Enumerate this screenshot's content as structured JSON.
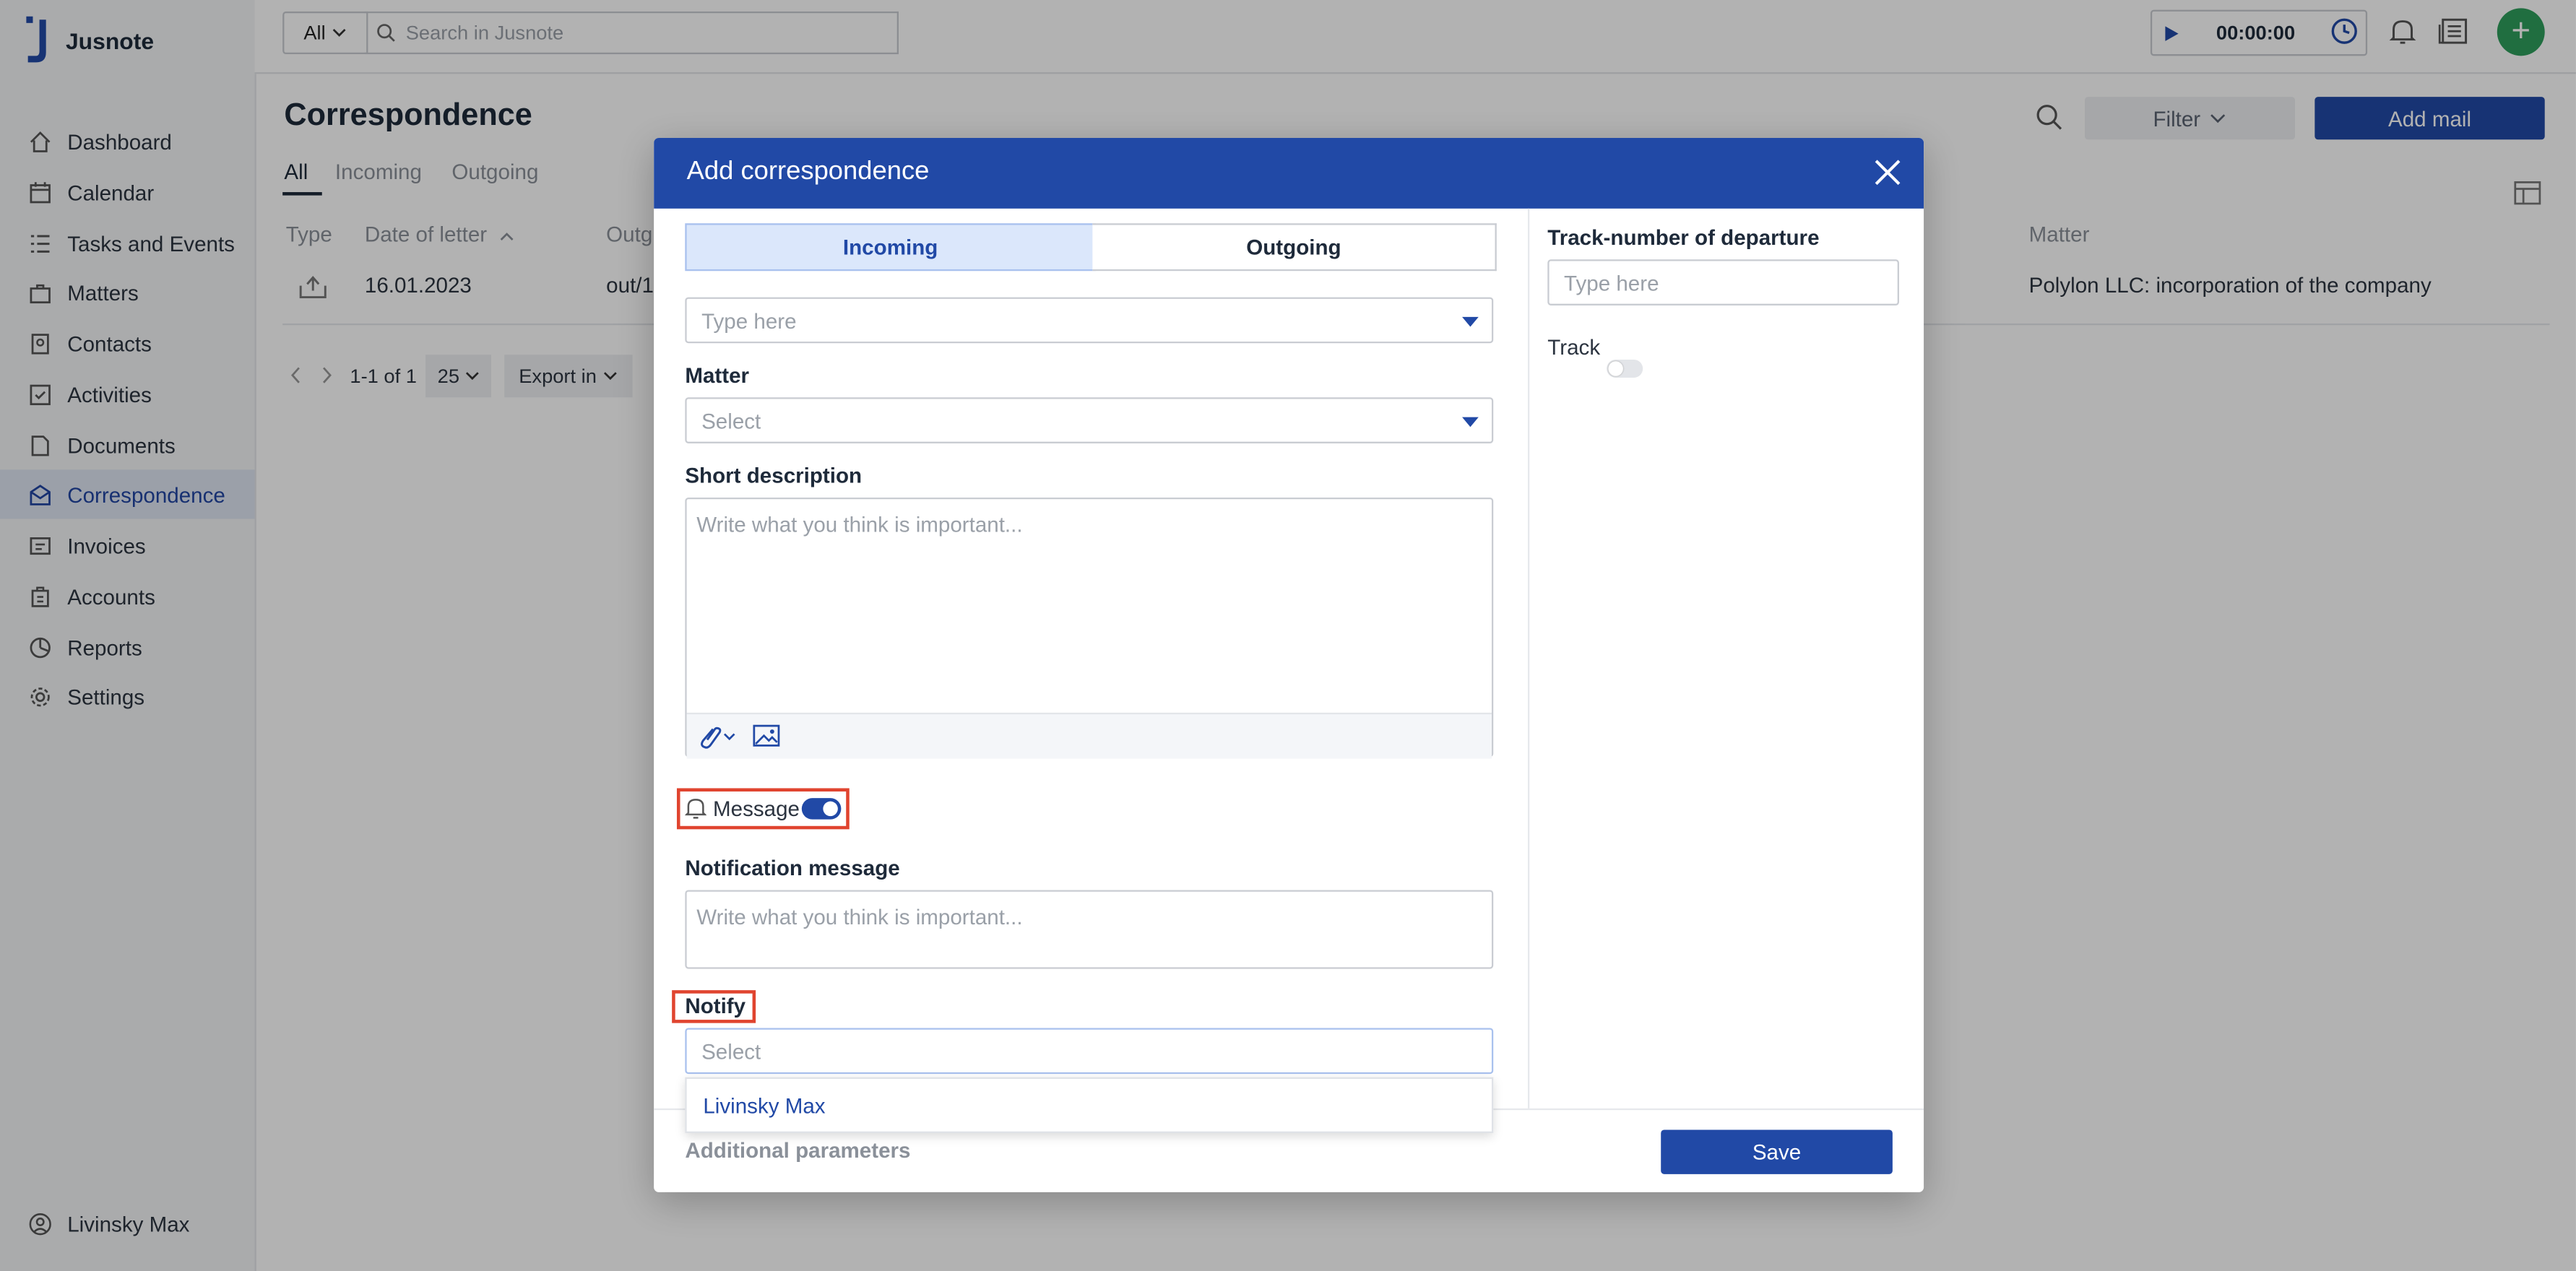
{
  "app": {
    "name": "Jusnote"
  },
  "topbar": {
    "scope": "All",
    "search_placeholder": "Search in Jusnote",
    "timer": "00:00:00"
  },
  "sidebar": {
    "items": [
      {
        "label": "Dashboard",
        "icon": "home-icon"
      },
      {
        "label": "Calendar",
        "icon": "calendar-icon"
      },
      {
        "label": "Tasks and Events",
        "icon": "tasks-icon"
      },
      {
        "label": "Matters",
        "icon": "briefcase-icon"
      },
      {
        "label": "Contacts",
        "icon": "contacts-icon"
      },
      {
        "label": "Activities",
        "icon": "activity-icon"
      },
      {
        "label": "Documents",
        "icon": "document-icon"
      },
      {
        "label": "Correspondence",
        "icon": "mail-icon",
        "active": true
      },
      {
        "label": "Invoices",
        "icon": "invoice-icon"
      },
      {
        "label": "Accounts",
        "icon": "accounts-icon"
      },
      {
        "label": "Reports",
        "icon": "reports-icon"
      },
      {
        "label": "Settings",
        "icon": "gear-icon"
      }
    ],
    "user": "Livinsky Max"
  },
  "page": {
    "title": "Correspondence",
    "tabs": [
      "All",
      "Incoming",
      "Outgoing"
    ],
    "filter_label": "Filter",
    "add_mail_label": "Add mail",
    "table": {
      "headers": {
        "type": "Type",
        "date": "Date of letter",
        "outgoing": "Outg",
        "matter": "Matter"
      },
      "row": {
        "date": "16.01.2023",
        "number": "out/1",
        "matter": "Polylon LLC: incorporation of the company"
      }
    },
    "pagination": {
      "range": "1-1 of 1",
      "per_page": "25",
      "export": "Export in"
    }
  },
  "modal": {
    "title": "Add correspondence",
    "direction": {
      "incoming": "Incoming",
      "outgoing": "Outgoing"
    },
    "type_placeholder": "Type here",
    "matter_label": "Matter",
    "matter_placeholder": "Select",
    "short_description_label": "Short description",
    "short_description_placeholder": "Write what you think is important...",
    "message_label": "Message",
    "notification_message_label": "Notification message",
    "notification_message_placeholder": "Write what you think is important...",
    "notify_label": "Notify",
    "notify_placeholder": "Select",
    "notify_option": "Livinsky Max",
    "additional_parameters": "Additional parameters",
    "save_label": "Save",
    "track_number_label": "Track-number of departure",
    "track_number_placeholder": "Type here",
    "track_label": "Track"
  },
  "colors": {
    "primary": "#2149a6",
    "add_button": "#2f9e5c",
    "highlight": "#e0442f"
  }
}
